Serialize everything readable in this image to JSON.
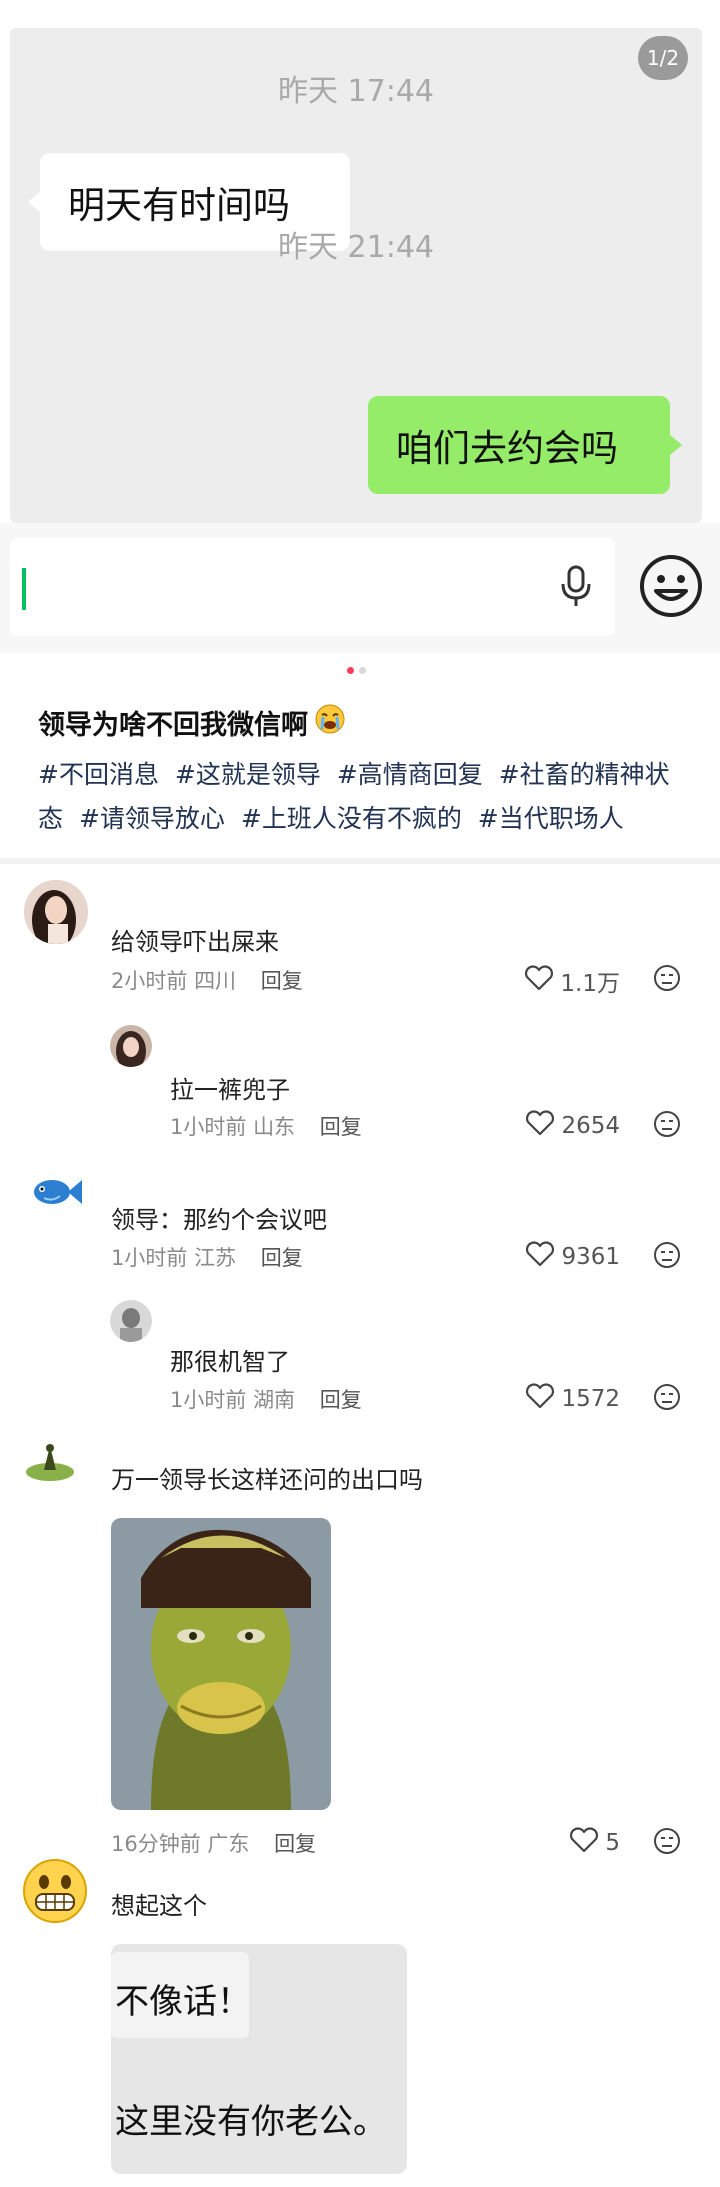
{
  "chat": {
    "page_indicator": "1/2",
    "time_1": "昨天 17:44",
    "msg_received": "明天有时间吗",
    "time_2": "昨天 21:44",
    "msg_sent": "咱们去约会吗"
  },
  "post": {
    "title": "领导为啥不回我微信啊",
    "title_emoji": "crying-emoji",
    "tags": [
      "#不回消息",
      "#这就是领导",
      "#高情商回复",
      "#社畜的精神状态",
      "#请领导放心",
      "#上班人没有不疯的",
      "#当代职场人"
    ]
  },
  "comments": [
    {
      "text": "给领导吓出屎来",
      "time": "2小时前",
      "location": "四川",
      "reply": "回复",
      "likes": "1.1万"
    },
    {
      "text": "拉一裤兜子",
      "time": "1小时前",
      "location": "山东",
      "reply": "回复",
      "likes": "2654"
    },
    {
      "text": "领导：那约个会议吧",
      "time": "1小时前",
      "location": "江苏",
      "reply": "回复",
      "likes": "9361"
    },
    {
      "text": "那很机智了",
      "time": "1小时前",
      "location": "湖南",
      "reply": "回复",
      "likes": "1572"
    },
    {
      "text": "万一领导长这样还问的出口吗",
      "time": "16分钟前",
      "location": "广东",
      "reply": "回复",
      "likes": "5"
    },
    {
      "text": "想起这个",
      "image_text_1": "不像话！",
      "image_text_2": "这里没有你老公。"
    }
  ],
  "colors": {
    "chat_bg": "#ededed",
    "sent_bubble": "#95ec69",
    "received_bubble": "#ffffff",
    "cursor": "#07c160",
    "hashtag": "#223353"
  }
}
